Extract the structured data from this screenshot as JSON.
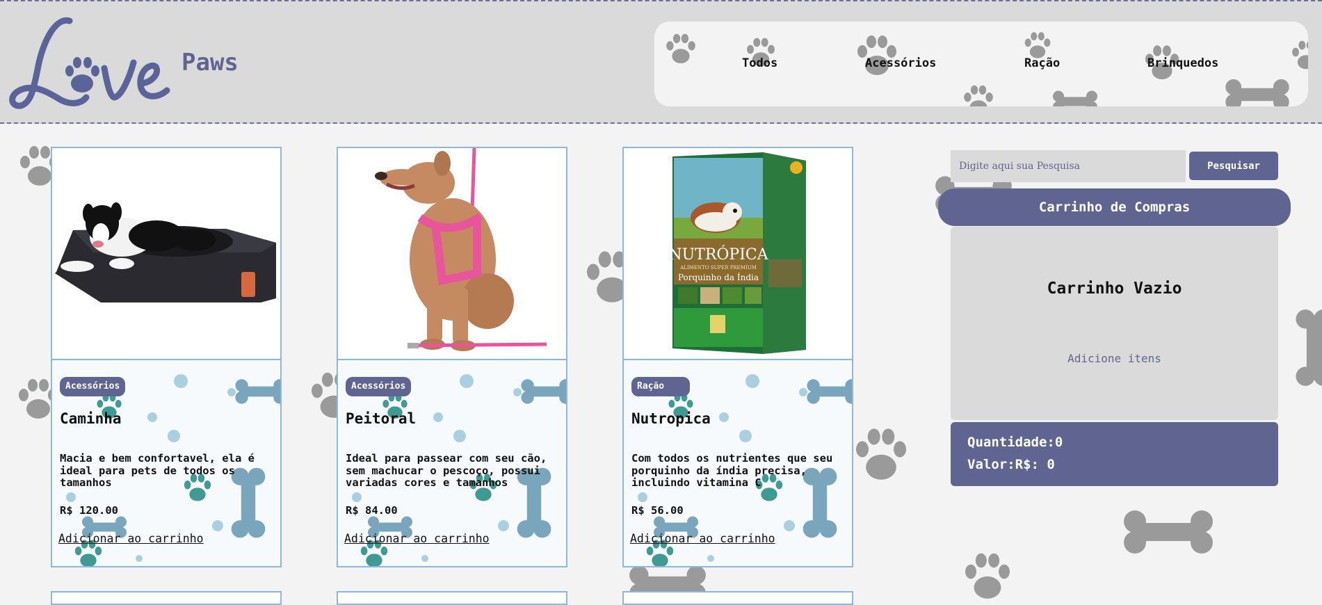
{
  "brand": {
    "logo_text": "Love",
    "name": "Paws"
  },
  "nav": {
    "items": [
      {
        "label": "Todos"
      },
      {
        "label": "Acessórios"
      },
      {
        "label": "Ração"
      },
      {
        "label": "Brinquedos"
      }
    ]
  },
  "products": [
    {
      "tag": "Acessórios",
      "title": "Caminha",
      "description": "Macia e bem confortavel, ela é ideal para pets de todos os tamanhos",
      "price": "R$ 120.00",
      "add_label": "Adicionar ao carrinho"
    },
    {
      "tag": "Acessórios",
      "title": "Peitoral",
      "description": "Ideal para passear com seu cão, sem machucar o pescoço, possui variadas cores e tamanhos",
      "price": "R$ 84.00",
      "add_label": "Adicionar ao carrinho"
    },
    {
      "tag": "Ração",
      "title": "Nutropica",
      "description": "Com todos os nutrientes que seu porquinho da índia precisa, incluindo vitamina C",
      "price": "R$ 56.00",
      "add_label": "Adicionar ao carrinho",
      "package_text": {
        "brand": "NUTRÓPICA",
        "subtitle": "ALIMENTO SUPER PREMIUM",
        "name": "Porquinho da Índia"
      }
    }
  ],
  "search": {
    "placeholder": "Digite aqui sua Pesquisa",
    "button_label": "Pesquisar"
  },
  "cart": {
    "title": "Carrinho de Compras",
    "empty_text": "Carrinho Vazio",
    "hint": "Adicione itens",
    "quantity_label": "Quantidade:0",
    "value_label": "Valor:R$: 0"
  },
  "colors": {
    "accent": "#5f6590",
    "header_bg": "#dadada",
    "card_border": "#8fb6dc",
    "teal": "#3e9a92"
  }
}
